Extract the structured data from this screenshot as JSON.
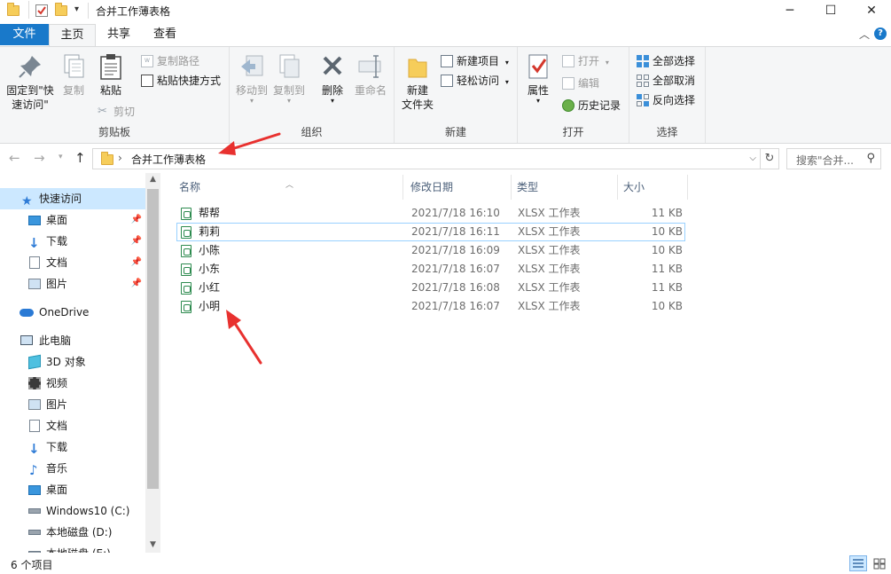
{
  "window": {
    "title": "合并工作薄表格",
    "minimize": "─",
    "maximize": "☐",
    "close": "✕"
  },
  "ribbon_tabs": [
    "文件",
    "主页",
    "共享",
    "查看"
  ],
  "ribbon": {
    "clipboard": {
      "group_label": "剪贴板",
      "pin_quick_access": "固定到\"快\n速访问\"",
      "copy": "复制",
      "paste": "粘贴",
      "copy_path": "复制路径",
      "paste_shortcut": "粘贴快捷方式",
      "cut": "剪切"
    },
    "organize": {
      "group_label": "组织",
      "move_to": "移动到",
      "copy_to": "复制到",
      "delete": "删除",
      "rename": "重命名"
    },
    "new": {
      "group_label": "新建",
      "new_folder": "新建\n文件夹",
      "new_item": "新建项目",
      "easy_access": "轻松访问"
    },
    "open": {
      "group_label": "打开",
      "properties": "属性",
      "open": "打开",
      "edit": "编辑",
      "history": "历史记录"
    },
    "select": {
      "group_label": "选择",
      "select_all": "全部选择",
      "select_none": "全部取消",
      "invert_selection": "反向选择"
    }
  },
  "address": {
    "path": "合并工作薄表格",
    "search_placeholder": "搜索\"合并..."
  },
  "navigation": {
    "quick_access": "快速访问",
    "quick_items": [
      "桌面",
      "下载",
      "文档",
      "图片"
    ],
    "onedrive": "OneDrive",
    "this_pc": "此电脑",
    "pc_items": [
      "3D 对象",
      "视频",
      "图片",
      "文档",
      "下载",
      "音乐",
      "桌面",
      "Windows10 (C:)",
      "本地磁盘 (D:)",
      "本地磁盘 (E:)"
    ]
  },
  "file_list": {
    "columns": [
      "名称",
      "修改日期",
      "类型",
      "大小"
    ],
    "files": [
      {
        "name": "帮帮",
        "modified": "2021/7/18 16:10",
        "type": "XLSX 工作表",
        "size": "11 KB"
      },
      {
        "name": "莉莉",
        "modified": "2021/7/18 16:11",
        "type": "XLSX 工作表",
        "size": "10 KB"
      },
      {
        "name": "小陈",
        "modified": "2021/7/18 16:09",
        "type": "XLSX 工作表",
        "size": "10 KB"
      },
      {
        "name": "小东",
        "modified": "2021/7/18 16:07",
        "type": "XLSX 工作表",
        "size": "11 KB"
      },
      {
        "name": "小红",
        "modified": "2021/7/18 16:08",
        "type": "XLSX 工作表",
        "size": "11 KB"
      },
      {
        "name": "小明",
        "modified": "2021/7/18 16:07",
        "type": "XLSX 工作表",
        "size": "10 KB"
      }
    ]
  },
  "status": {
    "item_count": "6 个项目"
  },
  "colors": {
    "accent": "#1979ca",
    "selection": "#cce8ff",
    "annotation_arrow": "#e8312f"
  }
}
